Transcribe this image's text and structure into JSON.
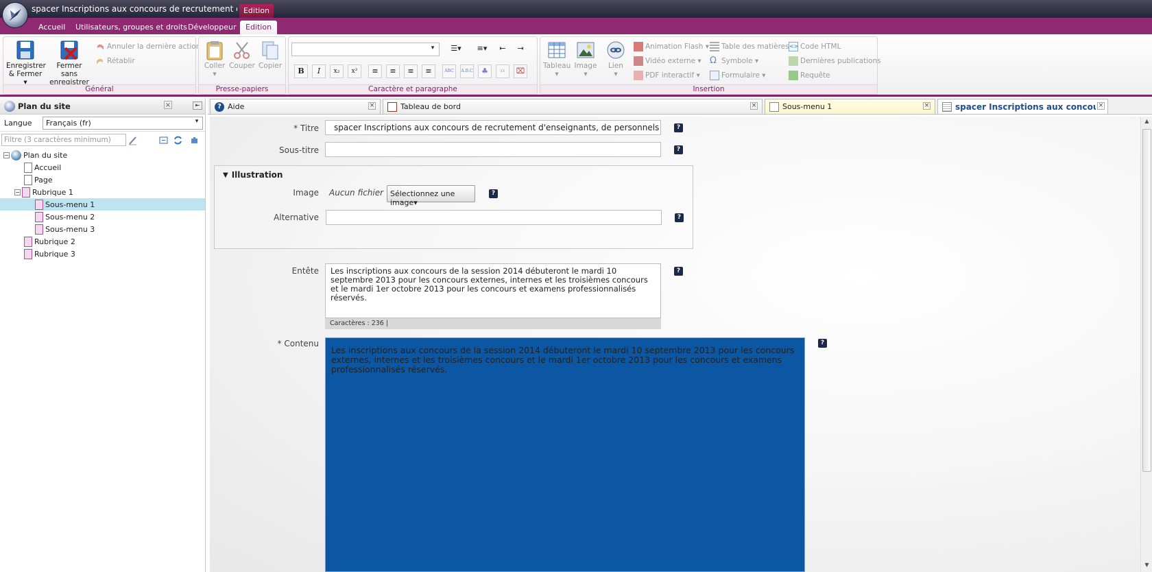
{
  "window": {
    "title": "spacer Inscriptions aux concours de recrutement d'enseignants",
    "context_tab": "Edition"
  },
  "ribbon_tabs": [
    "Accueil",
    "Utilisateurs, groupes et droits",
    "Développeur",
    "Edition"
  ],
  "ribbon": {
    "general": {
      "label": "Général",
      "save": "Enregistrer & Fermer",
      "save_line1": "Enregistrer",
      "save_line2": "& Fermer",
      "close_line1": "Fermer sans",
      "close_line2": "enregistrer",
      "undo": "Annuler la dernière action",
      "redo": "Rétablir"
    },
    "clipboard": {
      "label": "Presse-papiers",
      "paste": "Coller",
      "cut": "Couper",
      "copy": "Copier"
    },
    "charpara": {
      "label": "Caractère et paragraphe"
    },
    "insertion": {
      "label": "Insertion",
      "table": "Tableau",
      "image": "Image",
      "link": "Lien",
      "flash": "Animation Flash",
      "video": "Vidéo externe",
      "pdf": "PDF interactif",
      "toc": "Table des matières",
      "symbol": "Symbole",
      "form": "Formulaire",
      "html": "Code HTML",
      "latest": "Dernières publications",
      "query": "Requête"
    }
  },
  "left_panel": {
    "title": "Plan du site",
    "language_label": "Langue",
    "language_value": "Français (fr)",
    "filter_placeholder": "Filtre (3 caractères minimum)",
    "tree": [
      "Plan du site",
      "Accueil",
      "Page",
      "Rubrique 1",
      "Sous-menu 1",
      "Sous-menu 2",
      "Sous-menu 3",
      "Rubrique 2",
      "Rubrique 3"
    ]
  },
  "doc_tabs": [
    "Aide",
    "Tableau de bord",
    "Sous-menu 1",
    "spacer Inscriptions aux concours de"
  ],
  "form": {
    "titre_label": "* Titre",
    "titre_value": "spacer Inscriptions aux concours de recrutement d'enseignants, de personnels d'é",
    "soustitre_label": "Sous-titre",
    "soustitre_value": "",
    "illustration_legend": "Illustration",
    "image_label": "Image",
    "image_value": "Aucun fichier",
    "image_button": "Sélectionnez une image",
    "alt_label": "Alternative",
    "alt_value": "",
    "entete_label": "Entête",
    "entete_value": "Les inscriptions aux concours de la session 2014 débuteront le mardi 10 septembre 2013 pour les concours externes, internes et les troisièmes concours et le mardi 1er octobre 2013 pour les concours et examens professionnalisés réservés.",
    "char_count": "Caractères : 236",
    "contenu_label": "* Contenu",
    "contenu_value": "Les inscriptions aux concours de la session 2014 débuteront le mardi 10 septembre 2013 pour les concours externes, internes et les troisièmes concours et le mardi 1er octobre 2013 pour les concours et examens professionnalisés réservés.",
    "help": "?"
  },
  "colors": {
    "accent": "#8f2a72",
    "editor_bg": "#0b57a4",
    "selection": "#bde4f0"
  }
}
